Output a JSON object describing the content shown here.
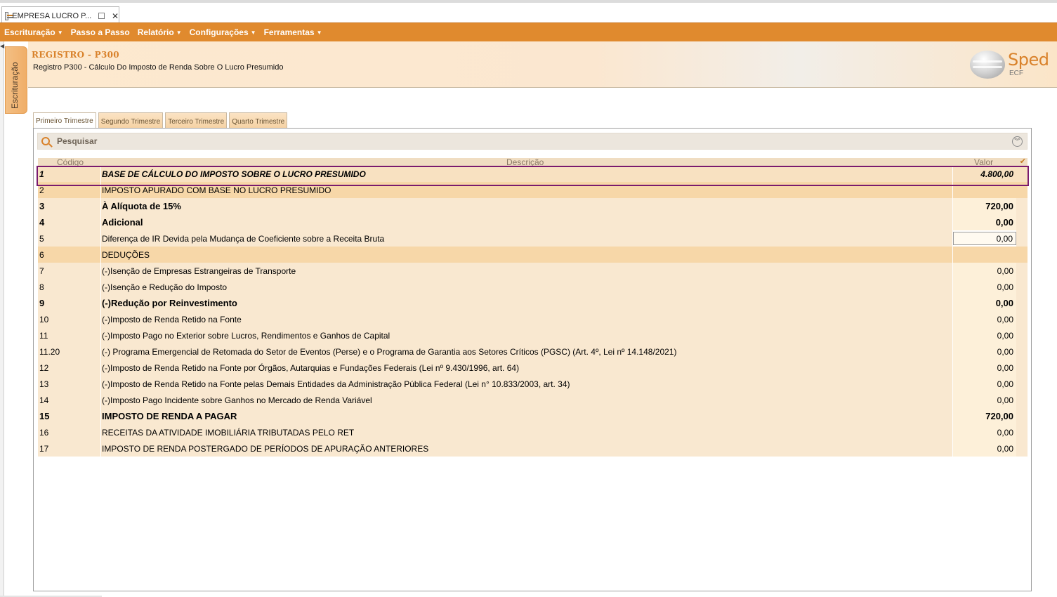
{
  "window": {
    "tab_title": "EMPRESA LUCRO P...",
    "maximize_glyph": "☐",
    "close_glyph": "✕"
  },
  "menu": [
    {
      "label": "Escrituração",
      "dropdown": true
    },
    {
      "label": "Passo a Passo",
      "dropdown": false
    },
    {
      "label": "Relatório",
      "dropdown": true
    },
    {
      "label": "Configurações",
      "dropdown": true
    },
    {
      "label": "Ferramentas",
      "dropdown": true
    }
  ],
  "side_tab": {
    "label": "Escrituração"
  },
  "header": {
    "title": "REGISTRO - P300",
    "subtitle": "Registro P300 - Cálculo Do Imposto de Renda Sobre O Lucro Presumido",
    "logo_text": "Sped",
    "logo_sub": "ECF"
  },
  "quarter_tabs": [
    {
      "label": "Primeiro Trimestre",
      "active": true
    },
    {
      "label": "Segundo Trimestre",
      "active": false
    },
    {
      "label": "Terceiro Trimestre",
      "active": false
    },
    {
      "label": "Quarto Trimestre",
      "active": false
    }
  ],
  "search": {
    "label": "Pesquisar"
  },
  "grid": {
    "columns": [
      "Código",
      "Descrição",
      "Valor"
    ],
    "rows": [
      {
        "code": "1",
        "desc": "BASE DE CÁLCULO DO IMPOSTO SOBRE O LUCRO PRESUMIDO",
        "value": "4.800,00",
        "style": "sel"
      },
      {
        "code": "2",
        "desc": "IMPOSTO APURADO COM BASE NO LUCRO PRESUMIDO",
        "value": "",
        "style": "group"
      },
      {
        "code": "3",
        "desc": "À Alíquota de 15%",
        "value": "720,00",
        "style": "bold"
      },
      {
        "code": "4",
        "desc": "Adicional",
        "value": "0,00",
        "style": "bold"
      },
      {
        "code": "5",
        "desc": "Diferença de IR Devida pela Mudança de Coeficiente sobre a Receita Bruta",
        "value": "0,00",
        "style": "editable"
      },
      {
        "code": "6",
        "desc": "DEDUÇÕES",
        "value": "",
        "style": "group"
      },
      {
        "code": "7",
        "desc": "(-)Isenção de Empresas Estrangeiras de Transporte",
        "value": "0,00",
        "style": "normal"
      },
      {
        "code": "8",
        "desc": "(-)Isenção e Redução do Imposto",
        "value": "0,00",
        "style": "normal"
      },
      {
        "code": "9",
        "desc": "(-)Redução por Reinvestimento",
        "value": "0,00",
        "style": "bold"
      },
      {
        "code": "10",
        "desc": "(-)Imposto de Renda Retido na Fonte",
        "value": "0,00",
        "style": "normal"
      },
      {
        "code": "11",
        "desc": "(-)Imposto Pago no Exterior sobre Lucros, Rendimentos e Ganhos de Capital",
        "value": "0,00",
        "style": "normal"
      },
      {
        "code": "11.20",
        "desc": "(-) Programa Emergencial de Retomada do Setor de Eventos (Perse) e o Programa de Garantia aos Setores Críticos (PGSC) (Art. 4º, Lei nº 14.148/2021)",
        "value": "0,00",
        "style": "normal"
      },
      {
        "code": "12",
        "desc": "(-)Imposto de Renda Retido na Fonte por Órgãos, Autarquias e Fundações Federais (Lei nº 9.430/1996, art. 64)",
        "value": "0,00",
        "style": "normal"
      },
      {
        "code": "13",
        "desc": "(-)Imposto de Renda Retido na Fonte pelas Demais Entidades da Administração Pública Federal (Lei n° 10.833/2003, art. 34)",
        "value": "0,00",
        "style": "normal"
      },
      {
        "code": "14",
        "desc": "(-)Imposto Pago Incidente sobre Ganhos no Mercado de Renda Variável",
        "value": "0,00",
        "style": "normal"
      },
      {
        "code": "15",
        "desc": "IMPOSTO DE RENDA A PAGAR",
        "value": "720,00",
        "style": "bold"
      },
      {
        "code": "16",
        "desc": "RECEITAS DA ATIVIDADE IMOBILIÁRIA TRIBUTADAS PELO RET",
        "value": "0,00",
        "style": "normal"
      },
      {
        "code": "17",
        "desc": "IMPOSTO DE RENDA POSTERGADO DE PERÍODOS DE APURAÇÃO ANTERIORES",
        "value": "0,00",
        "style": "normal"
      }
    ]
  },
  "colors": {
    "menu_bg": "#e08a2e",
    "accent": "#d9822b",
    "row_bg": "#f9e8d0",
    "group_bg": "#f7d7a8",
    "selection_border": "#7a1a6e"
  }
}
